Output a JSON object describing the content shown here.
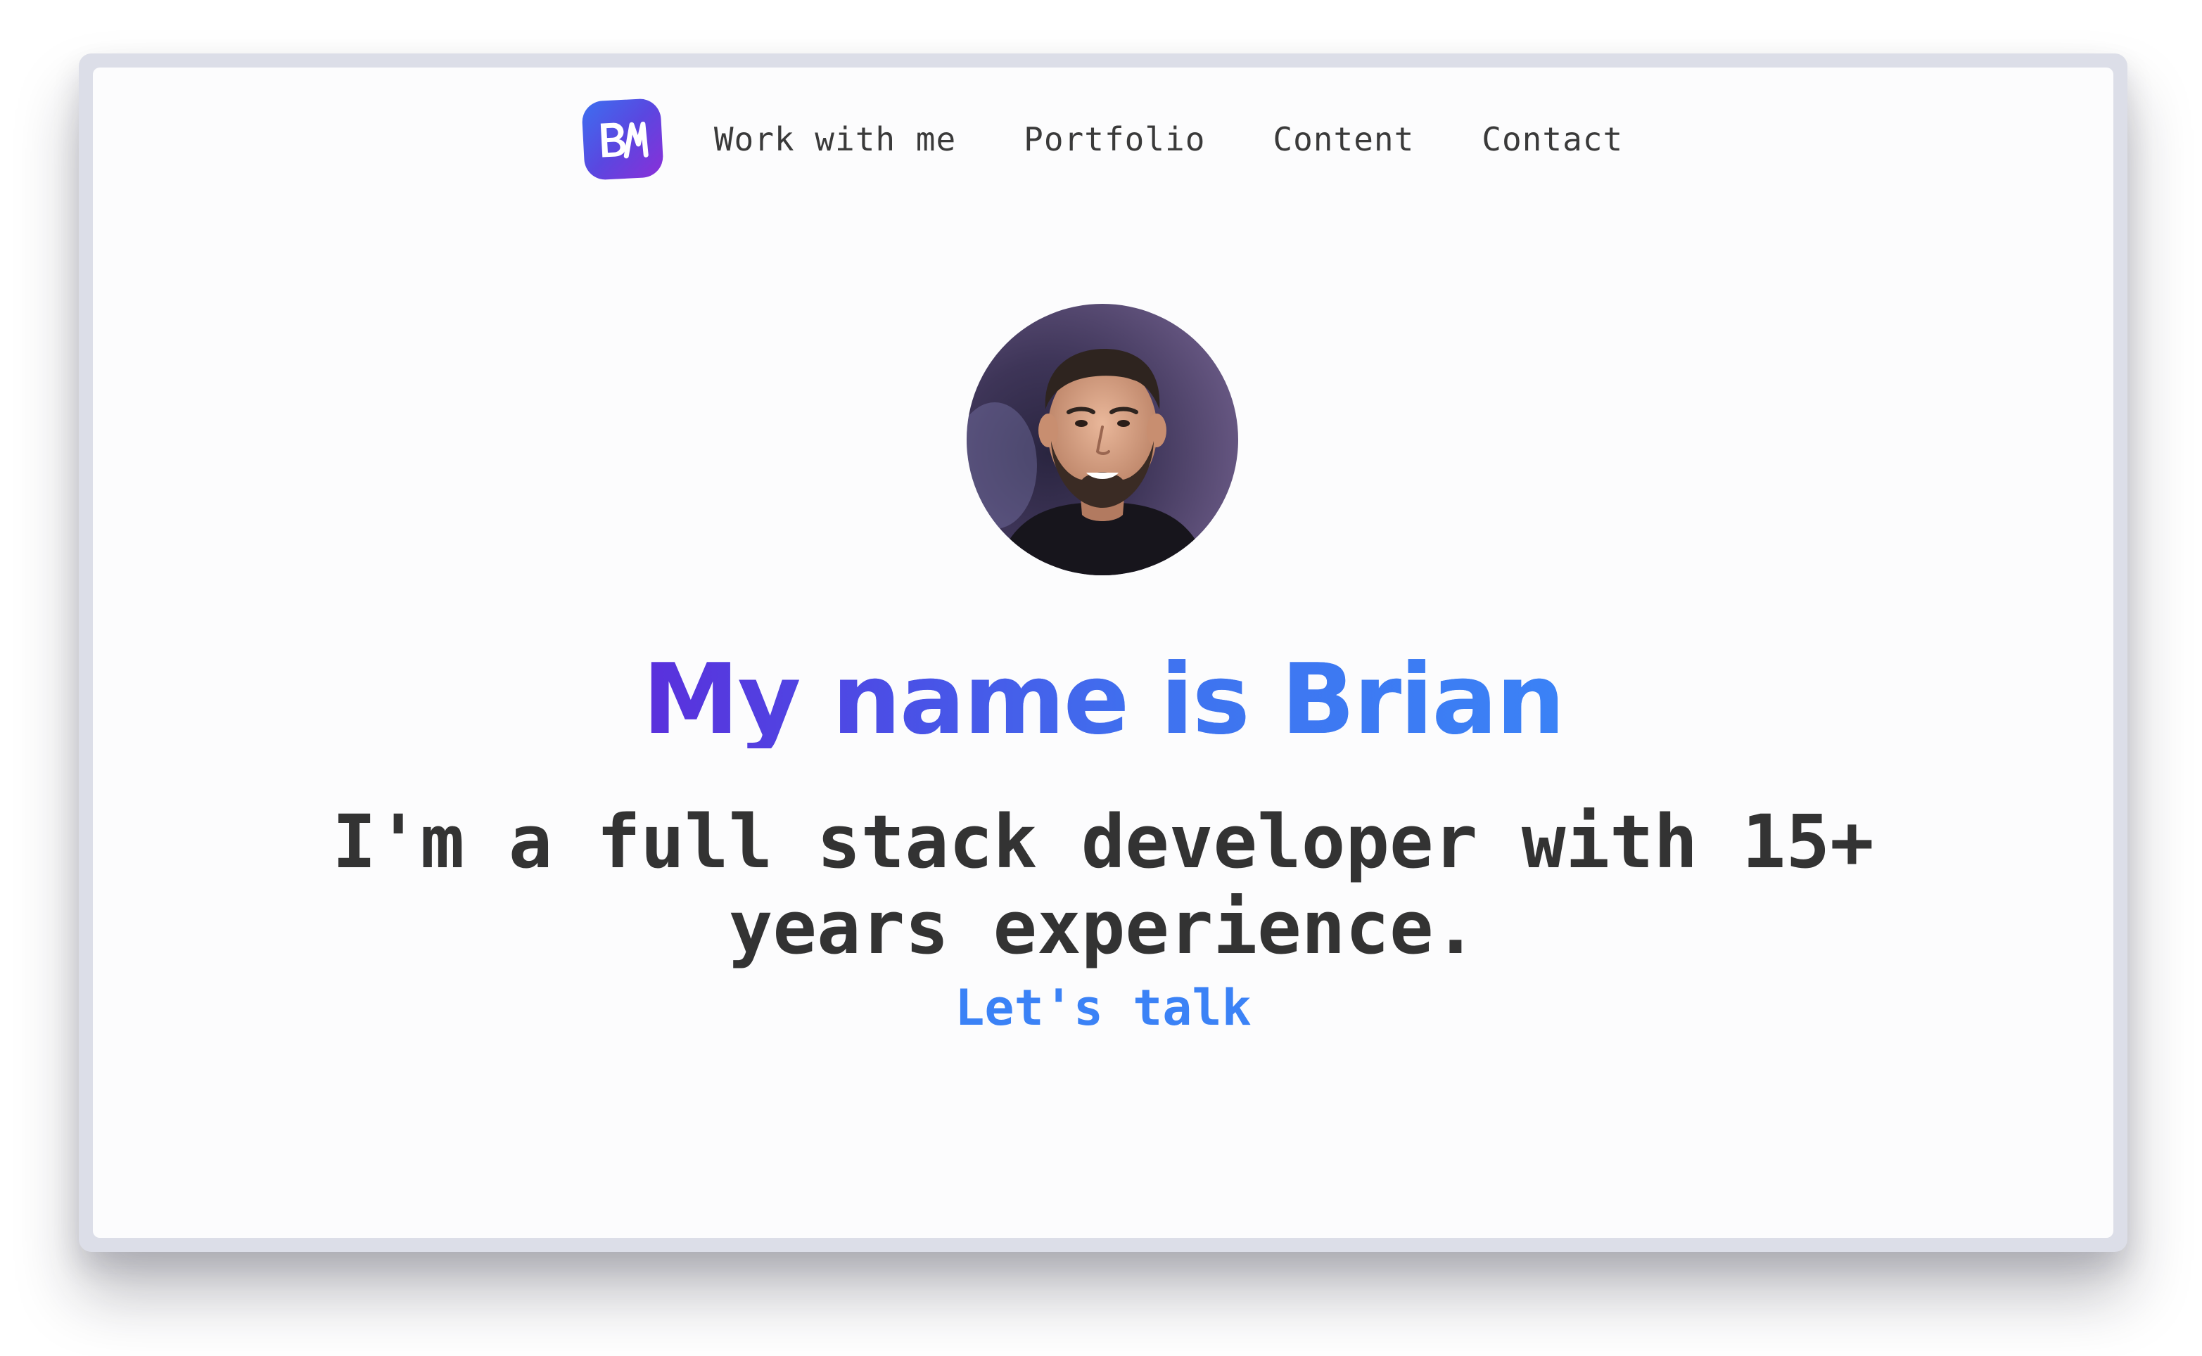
{
  "nav": {
    "logo_icon": "bm-monogram-logo",
    "links": [
      {
        "label": "Work with me"
      },
      {
        "label": "Portfolio"
      },
      {
        "label": "Content"
      },
      {
        "label": "Contact"
      }
    ]
  },
  "hero": {
    "avatar_icon": "profile-photo",
    "headline": "My name is Brian",
    "subheadline": "I'm a full stack developer with 15+ years experience.",
    "cta_label": "Let's talk"
  },
  "colors": {
    "accent": "#3b82f6",
    "accent_purple": "#5a30dc",
    "text": "#333333",
    "logo_gradient_start": "#3c6ff0",
    "logo_gradient_end": "#8a2fd8"
  }
}
